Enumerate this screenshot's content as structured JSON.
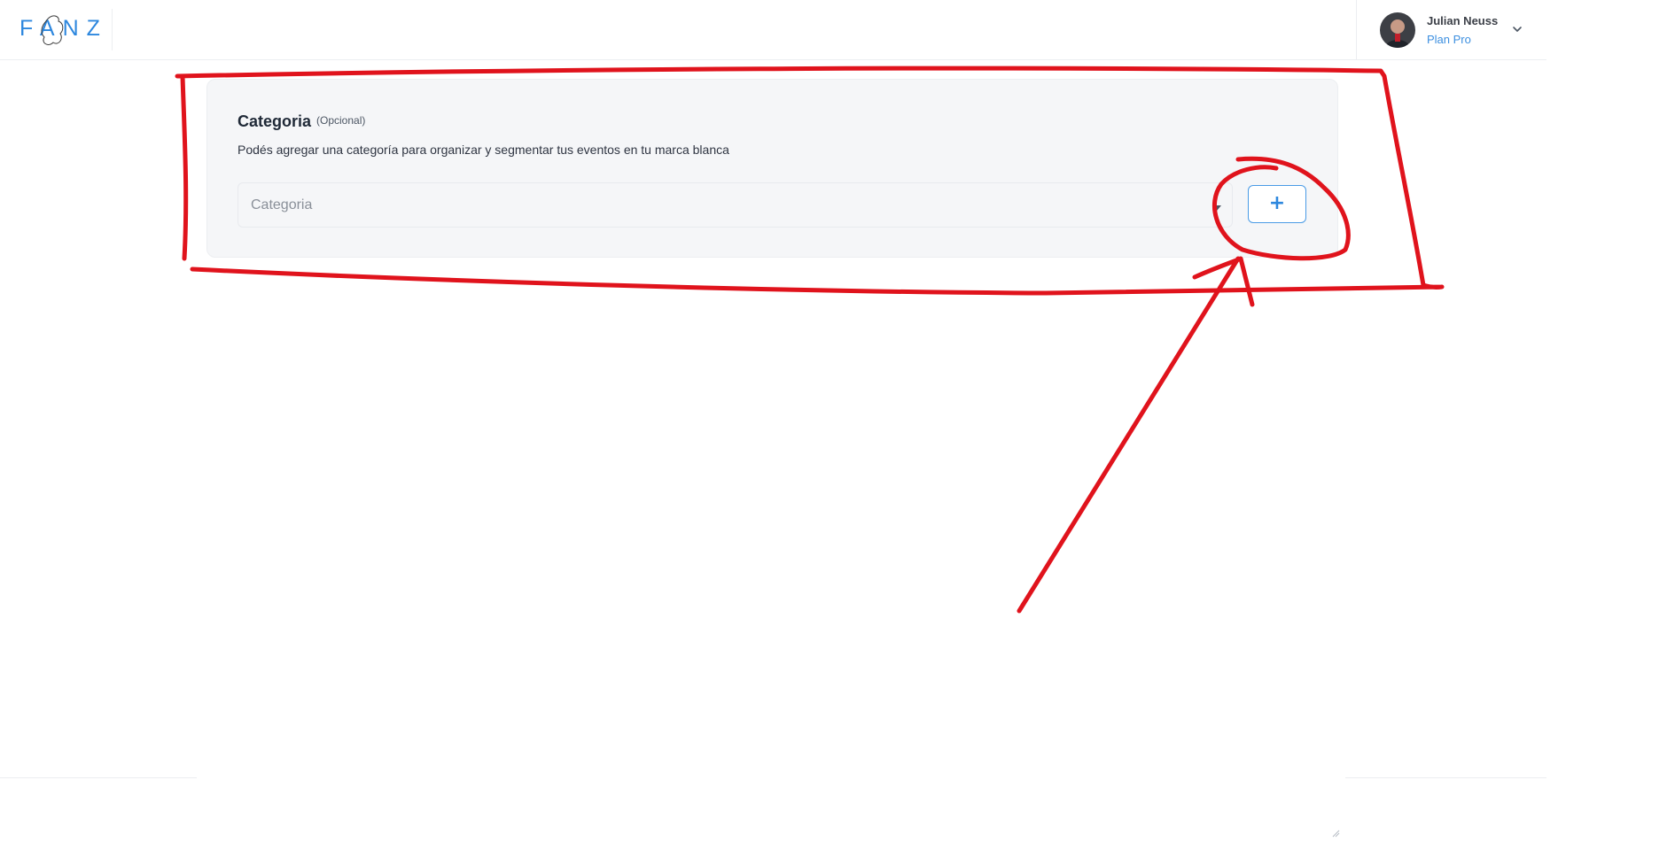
{
  "header": {
    "logo_text": "FANZ",
    "user": {
      "name": "Julian Neuss",
      "plan": "Plan Pro"
    }
  },
  "category_card": {
    "title": "Categoria",
    "optional_label": "(Opcional)",
    "description": "Podés agregar una categoría para organizar y segmentar tus eventos en tu marca blanca",
    "select_placeholder": "Categoria",
    "add_button_label": "+"
  },
  "colors": {
    "brand_blue": "#2d87de",
    "annotation_red": "#e0131c",
    "card_background": "#f5f6f8"
  },
  "icons": {
    "user_menu": "chevron-down-icon",
    "select_toggle": "caret-down-icon"
  }
}
